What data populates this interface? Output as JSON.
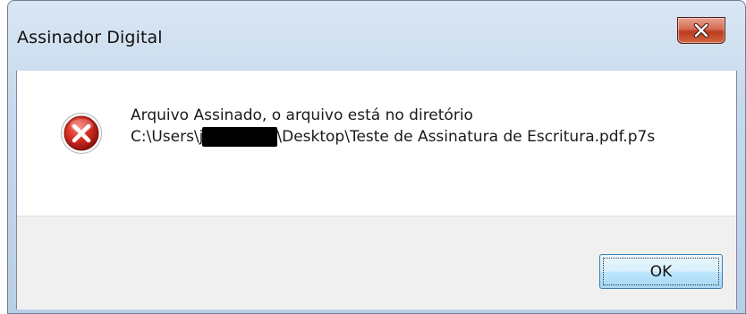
{
  "window": {
    "title": "Assinador Digital",
    "close_label": "x"
  },
  "message": {
    "line1": "Arquivo Assinado, o arquivo está no diretório",
    "path_prefix": "C:\\Users\\j",
    "path_suffix": "\\Desktop\\Teste de Assinatura de Escritura.pdf.p7s"
  },
  "icons": {
    "error": "error-icon",
    "close": "close-icon"
  },
  "buttons": {
    "ok_label": "OK"
  },
  "colors": {
    "error_red": "#d32a1f",
    "close_red": "#c7452a",
    "button_border": "#3c7fb1"
  }
}
